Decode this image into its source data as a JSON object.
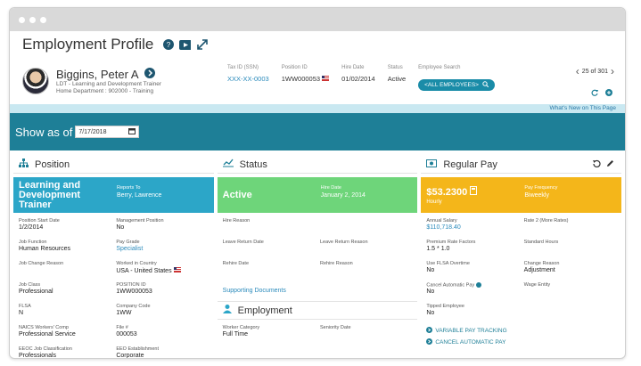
{
  "window": {
    "controls": [
      "dot",
      "dot",
      "dot"
    ]
  },
  "header": {
    "title": "Employment Profile",
    "icons": [
      "help-icon",
      "video-icon",
      "expand-icon"
    ]
  },
  "employee": {
    "name": "Biggins, Peter A",
    "title_line": "LDT - Learning and Development Trainer",
    "department_line": "Home Department : 902000 - Training",
    "fields": {
      "tax_id_label": "Tax ID (SSN)",
      "tax_id_value": "XXX-XX-0003",
      "position_id_label": "Position ID",
      "position_id_value": "1WW000053",
      "hire_date_label": "Hire Date",
      "hire_date_value": "01/02/2014",
      "status_label": "Status",
      "status_value": "Active",
      "search_label": "Employee Search",
      "search_value": "<ALL EMPLOYEES>"
    },
    "pager": "25 of 301"
  },
  "whats_new": "What's New on This Page",
  "show_as": {
    "label": "Show as of",
    "date": "7/17/2018"
  },
  "position": {
    "title": "Position",
    "hero_title": "Learning and Development Trainer",
    "reports_to_label": "Reports To",
    "reports_to_value": "Berry, Lawrence",
    "cells": [
      {
        "label": "Position Start Date",
        "value": "1/2/2014"
      },
      {
        "label": "Management Position",
        "value": "No"
      },
      {
        "label": "Job Function",
        "value": "Human Resources"
      },
      {
        "label": "Pay Grade",
        "value": "Specialist"
      },
      {
        "label": "Job Change Reason",
        "value": ""
      },
      {
        "label": "Worked in Country",
        "value": "USA - United States"
      },
      {
        "label": "Job Class",
        "value": "Professional"
      },
      {
        "label": "POSITION ID",
        "value": "1WW000053"
      },
      {
        "label": "FLSA",
        "value": "N"
      },
      {
        "label": "Company Code",
        "value": "1WW"
      },
      {
        "label": "NAICS Workers' Comp",
        "value": "Professional Service"
      },
      {
        "label": "File #",
        "value": "000053"
      },
      {
        "label": "EEOC Job Classification",
        "value": "Professionals"
      },
      {
        "label": "EEO Establishment",
        "value": "Corporate"
      }
    ]
  },
  "status": {
    "title": "Status",
    "hero_title": "Active",
    "hire_date_label": "Hire Date",
    "hire_date_value": "January 2, 2014",
    "cells": [
      {
        "label": "Hire Reason",
        "value": ""
      },
      {
        "label": "",
        "value": ""
      },
      {
        "label": "Leave Return Date",
        "value": ""
      },
      {
        "label": "Leave Return Reason",
        "value": ""
      },
      {
        "label": "Rehire Date",
        "value": ""
      },
      {
        "label": "Rehire Reason",
        "value": ""
      }
    ],
    "supporting_documents": "Supporting Documents"
  },
  "employment": {
    "title": "Employment",
    "cells": [
      {
        "label": "Worker Category",
        "value": "Full Time"
      },
      {
        "label": "Seniority Date",
        "value": ""
      }
    ]
  },
  "regular_pay": {
    "title": "Regular Pay",
    "hero_amount": "$53.2300",
    "hero_unit": "Hourly",
    "frequency_label": "Pay Frequency",
    "frequency_value": "Biweekly",
    "cells": [
      {
        "label": "Annual Salary",
        "value": "$110,718.40"
      },
      {
        "label": "Rate 2 (More Rates)",
        "value": ""
      },
      {
        "label": "Premium Rate Factors",
        "value": "1.5 * 1.0"
      },
      {
        "label": "Standard Hours",
        "value": ""
      },
      {
        "label": "Use FLSA Overtime",
        "value": "No"
      },
      {
        "label": "Change Reason",
        "value": "Adjustment"
      },
      {
        "label": "Cancel Automatic Pay",
        "value": "No"
      },
      {
        "label": "Wage Entity",
        "value": ""
      },
      {
        "label": "Tipped Employee",
        "value": "No"
      },
      {
        "label": "",
        "value": ""
      }
    ],
    "actions": [
      "VARIABLE PAY TRACKING",
      "CANCEL AUTOMATIC PAY"
    ]
  },
  "colors": {
    "teal": "#1e7f97",
    "blue": "#2ca6c8",
    "green": "#6ed57a",
    "gold": "#f4b61a"
  }
}
